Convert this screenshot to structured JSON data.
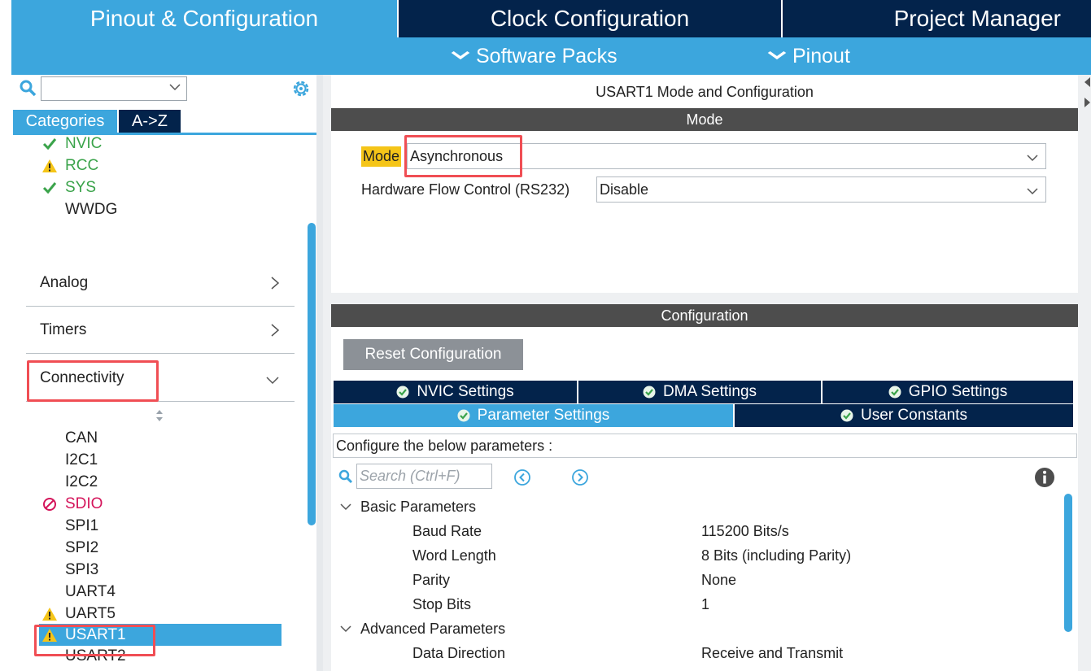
{
  "top_tabs": [
    {
      "label": "Pinout & Configuration",
      "active": true
    },
    {
      "label": "Clock Configuration",
      "active": false
    },
    {
      "label": "Project Manager",
      "active": false
    }
  ],
  "sub_menu": [
    {
      "label": "Software Packs"
    },
    {
      "label": "Pinout"
    }
  ],
  "left": {
    "search_value": "",
    "view_tabs": [
      {
        "label": "Categories",
        "active": true
      },
      {
        "label": "A->Z",
        "active": false
      }
    ],
    "system_items": [
      {
        "label": "NVIC",
        "status": "ok"
      },
      {
        "label": "RCC",
        "status": "warning"
      },
      {
        "label": "SYS",
        "status": "ok"
      },
      {
        "label": "WWDG",
        "status": "none"
      }
    ],
    "sections": [
      {
        "label": "Analog",
        "expanded": false
      },
      {
        "label": "Timers",
        "expanded": false
      },
      {
        "label": "Connectivity",
        "expanded": true
      }
    ],
    "connectivity_items": [
      {
        "label": "CAN",
        "status": "none"
      },
      {
        "label": "I2C1",
        "status": "none"
      },
      {
        "label": "I2C2",
        "status": "none"
      },
      {
        "label": "SDIO",
        "status": "blocked"
      },
      {
        "label": "SPI1",
        "status": "none"
      },
      {
        "label": "SPI2",
        "status": "none"
      },
      {
        "label": "SPI3",
        "status": "none"
      },
      {
        "label": "UART4",
        "status": "none"
      },
      {
        "label": "UART5",
        "status": "warning"
      },
      {
        "label": "USART1",
        "status": "warning",
        "selected": true
      },
      {
        "label": "USART2",
        "status": "none"
      }
    ]
  },
  "right": {
    "title": "USART1 Mode and Configuration",
    "mode_header": "Mode",
    "mode_label": "Mode",
    "mode_value": "Asynchronous",
    "hfc_label": "Hardware Flow Control (RS232)",
    "hfc_value": "Disable",
    "config_header": "Configuration",
    "reset_label": "Reset Configuration",
    "settings_tabs_row1": [
      {
        "label": "NVIC Settings"
      },
      {
        "label": "DMA Settings"
      },
      {
        "label": "GPIO Settings"
      }
    ],
    "settings_tabs_row2": [
      {
        "label": "Parameter Settings",
        "active": true
      },
      {
        "label": "User Constants",
        "active": false
      }
    ],
    "configure_text": "Configure the below parameters :",
    "search_placeholder": "Search (Ctrl+F)",
    "groups": [
      {
        "label": "Basic Parameters",
        "params": [
          {
            "name": "Baud Rate",
            "value": "115200 Bits/s"
          },
          {
            "name": "Word Length",
            "value": "8 Bits (including Parity)"
          },
          {
            "name": "Parity",
            "value": "None"
          },
          {
            "name": "Stop Bits",
            "value": "1"
          }
        ]
      },
      {
        "label": "Advanced Parameters",
        "params": [
          {
            "name": "Data Direction",
            "value": "Receive and Transmit"
          }
        ]
      }
    ]
  },
  "colors": {
    "accent": "#3ca6dd",
    "navy": "#03234b",
    "header_gray": "#4d4d4d",
    "highlight_red": "#f04e54",
    "mode_label_yellow": "#f5c518",
    "ok_green": "#3aa34a",
    "warning_yellow": "#f5c518",
    "blocked_magenta": "#d4145a"
  }
}
